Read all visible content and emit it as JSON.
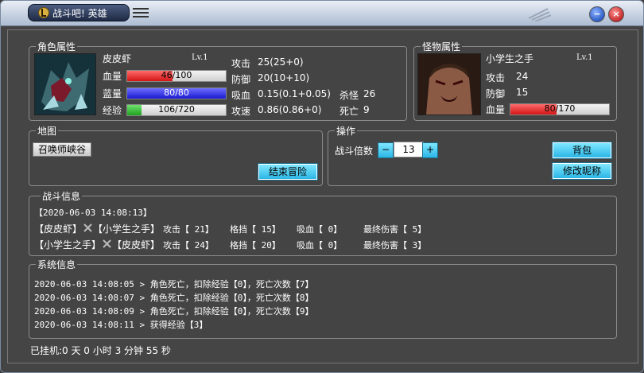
{
  "window": {
    "title": "战斗吧! 英雄",
    "minimize": "−",
    "close": "×"
  },
  "hero": {
    "section": "角色属性",
    "name": "皮皮虾",
    "level": "Lv.1",
    "hp_label": "血量",
    "hp_text": "46/100",
    "hp_fraction": 0.46,
    "mp_label": "蓝量",
    "mp_text": "80/80",
    "mp_fraction": 1.0,
    "xp_label": "经验",
    "xp_text": "106/720",
    "xp_fraction": 0.147,
    "stats": [
      {
        "label": "攻击",
        "value": "25(25+0)"
      },
      {
        "label": "防御",
        "value": "20(10+10)"
      },
      {
        "label": "吸血",
        "value": "0.15(0.1+0.05)"
      },
      {
        "label": "攻速",
        "value": "0.86(0.86+0)"
      }
    ],
    "kills_label": "杀怪",
    "kills": "26",
    "deaths_label": "死亡",
    "deaths": "9"
  },
  "monster": {
    "section": "怪物属性",
    "name": "小学生之手",
    "level": "Lv.1",
    "atk_label": "攻击",
    "atk": "24",
    "def_label": "防御",
    "def": "15",
    "hp_label": "血量",
    "hp_text": "80/170",
    "hp_fraction": 0.47
  },
  "map": {
    "section": "地图",
    "current": "召唤师峡谷",
    "end_button": "结束冒险"
  },
  "ops": {
    "section": "操作",
    "multiplier_label": "战斗倍数",
    "minus": "−",
    "value": "13",
    "plus": "+",
    "bag_button": "背包",
    "rename_button": "修改昵称"
  },
  "battle": {
    "section": "战斗信息",
    "timestamp": "【2020-06-03 14:08:13】",
    "rows": [
      {
        "attacker": "【皮皮虾】",
        "target": "【小学生之手】",
        "atk": "攻击【    21】",
        "block": "格挡【    15】",
        "lifesteal": "吸血【     0】",
        "final": "最终伤害【    5】"
      },
      {
        "attacker": "【小学生之手】",
        "target": "【皮皮虾】",
        "atk": "攻击【    24】",
        "block": "格挡【    20】",
        "lifesteal": "吸血【     0】",
        "final": "最终伤害【    3】"
      }
    ]
  },
  "system": {
    "section": "系统信息",
    "lines": [
      "2020-06-03 14:08:05 > 角色死亡，扣除经验【0】，死亡次数【7】",
      "2020-06-03 14:08:07 > 角色死亡，扣除经验【0】，死亡次数【8】",
      "2020-06-03 14:08:09 > 角色死亡，扣除经验【0】，死亡次数【9】",
      "2020-06-03 14:08:11 > 获得经验【3】"
    ]
  },
  "status": {
    "uptime": "已挂机:0 天 0 小时 3 分钟 55 秒"
  }
}
